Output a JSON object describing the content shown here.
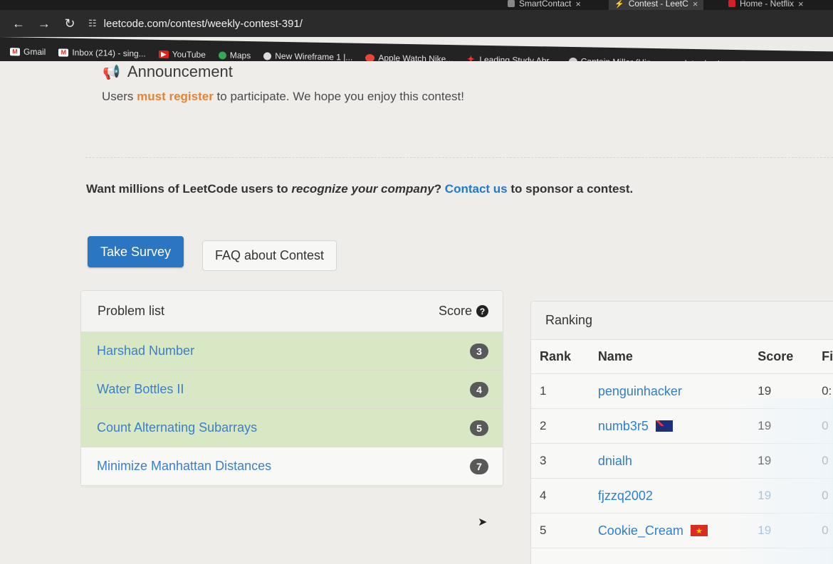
{
  "browser": {
    "tabs": [
      {
        "title": "SmartContact",
        "close": "×"
      },
      {
        "title": "Contest - LeetC",
        "close": "×"
      },
      {
        "title": "Home - Netflix",
        "close": "×"
      }
    ],
    "url": "leetcode.com/contest/weekly-contest-391/",
    "bookmarks": [
      "Gmail",
      "Inbox (214) - sing...",
      "YouTube",
      "Maps",
      "New Wireframe 1 |...",
      "Apple Watch Nike...",
      "Leading Study Abr...",
      "Captain Miller (Hin...",
      "Introduction to Fre..."
    ]
  },
  "announcement": {
    "title": "Announcement",
    "text_before": "Users ",
    "highlight": "must register",
    "text_after": " to participate. We hope you enjoy this contest!"
  },
  "sponsor": {
    "part1": "Want millions of LeetCode users to ",
    "italic": "recognize your company",
    "part2": "? ",
    "link": "Contact us",
    "part3": " to sponsor a contest."
  },
  "buttons": {
    "survey": "Take Survey",
    "faq": "FAQ about Contest"
  },
  "problem_list": {
    "title": "Problem list",
    "score_label": "Score",
    "problems": [
      {
        "name": "Harshad Number",
        "score": "3"
      },
      {
        "name": "Water Bottles II",
        "score": "4"
      },
      {
        "name": "Count Alternating Subarrays",
        "score": "5"
      },
      {
        "name": "Minimize Manhattan Distances",
        "score": "7"
      }
    ]
  },
  "ranking": {
    "title": "Ranking",
    "columns": {
      "rank": "Rank",
      "name": "Name",
      "score": "Score",
      "finish": "Fi"
    },
    "rows": [
      {
        "rank": "1",
        "name": "penguinhacker",
        "score": "19",
        "finish": "0:"
      },
      {
        "rank": "2",
        "name": "numb3r5",
        "score": "19",
        "finish": "0"
      },
      {
        "rank": "3",
        "name": "dnialh",
        "score": "19",
        "finish": "0"
      },
      {
        "rank": "4",
        "name": "fjzzq2002",
        "score": "19",
        "finish": "0"
      },
      {
        "rank": "5",
        "name": "Cookie_Cream",
        "score": "19",
        "finish": "0"
      }
    ]
  },
  "colors": {
    "accent_blue": "#2a76c2",
    "highlight_orange": "#e3843a",
    "solved_green": "#d9e8c4"
  }
}
